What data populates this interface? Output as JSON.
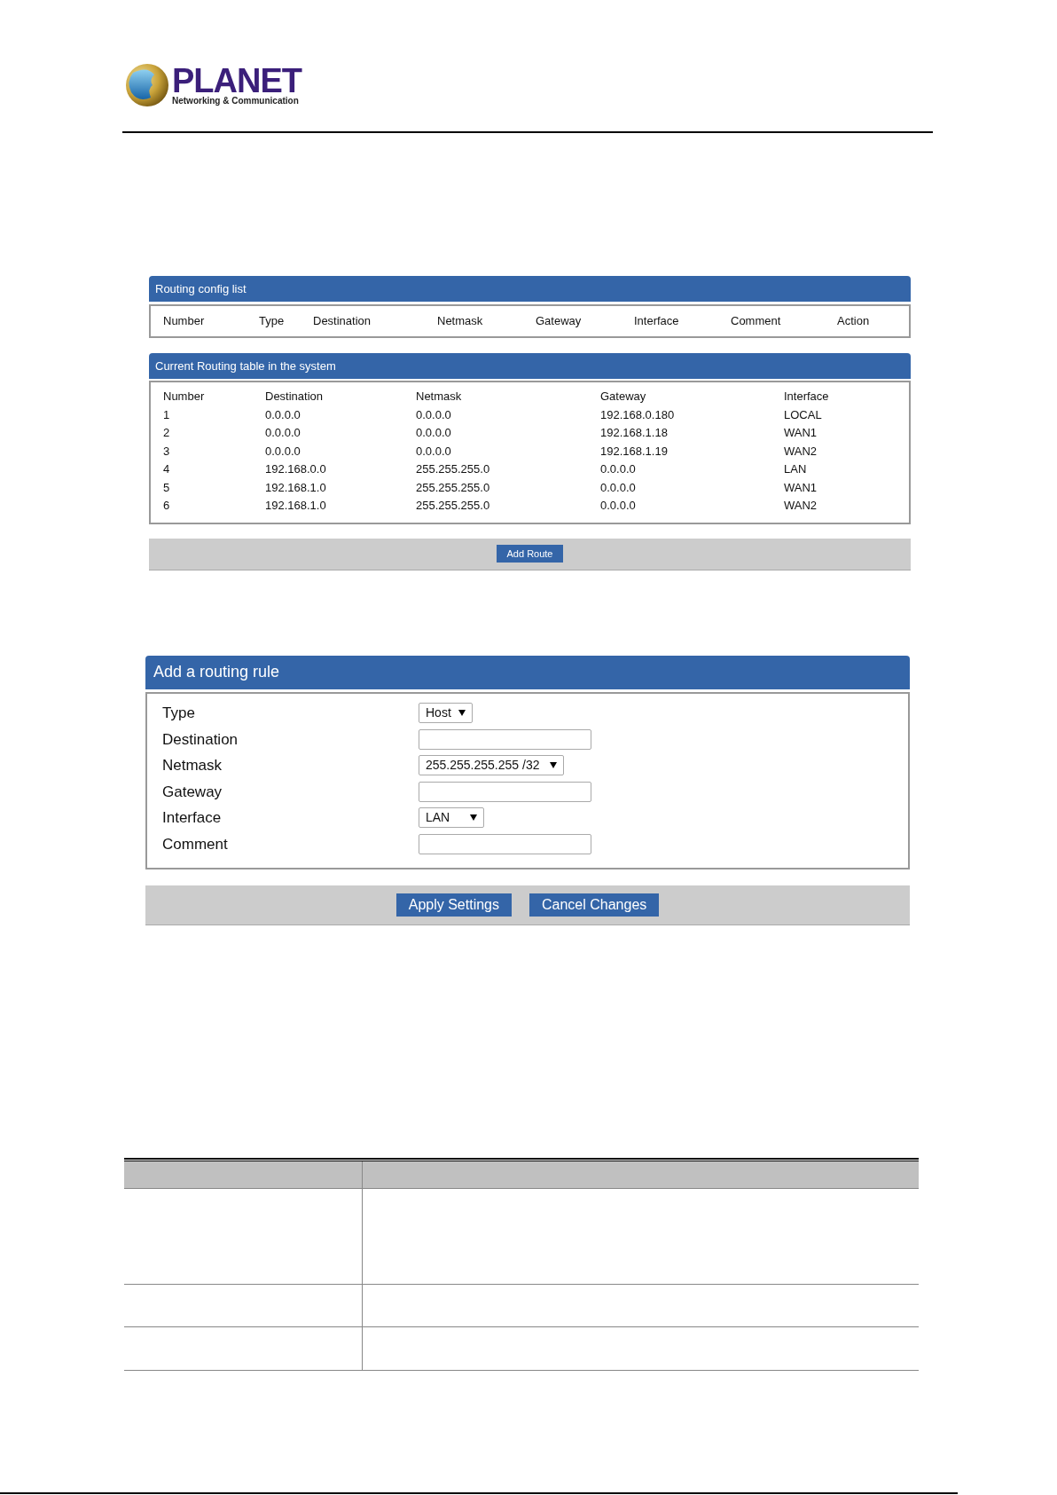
{
  "logo": {
    "name": "PLANET",
    "tagline": "Networking & Communication"
  },
  "config_list": {
    "title": "Routing config list",
    "columns": [
      "Number",
      "Type",
      "Destination",
      "Netmask",
      "Gateway",
      "Interface",
      "Comment",
      "Action"
    ]
  },
  "routing_table": {
    "title": "Current Routing table in the system",
    "columns": [
      "Number",
      "Destination",
      "Netmask",
      "Gateway",
      "Interface"
    ],
    "rows": [
      [
        "1",
        "0.0.0.0",
        "0.0.0.0",
        "192.168.0.180",
        "LOCAL"
      ],
      [
        "2",
        "0.0.0.0",
        "0.0.0.0",
        "192.168.1.18",
        "WAN1"
      ],
      [
        "3",
        "0.0.0.0",
        "0.0.0.0",
        "192.168.1.19",
        "WAN2"
      ],
      [
        "4",
        "192.168.0.0",
        "255.255.255.0",
        "0.0.0.0",
        "LAN"
      ],
      [
        "5",
        "192.168.1.0",
        "255.255.255.0",
        "0.0.0.0",
        "WAN1"
      ],
      [
        "6",
        "192.168.1.0",
        "255.255.255.0",
        "0.0.0.0",
        "WAN2"
      ]
    ]
  },
  "add_button": "Add Route",
  "add_rule": {
    "title": "Add a routing rule",
    "fields": [
      {
        "label": "Type",
        "kind": "select",
        "value": "Host"
      },
      {
        "label": "Destination",
        "kind": "text"
      },
      {
        "label": "Netmask",
        "kind": "select",
        "value": "255.255.255.255 /32"
      },
      {
        "label": "Gateway",
        "kind": "text"
      },
      {
        "label": "Interface",
        "kind": "select",
        "value": "LAN"
      },
      {
        "label": "Comment",
        "kind": "text"
      }
    ]
  },
  "buttons": [
    "Apply Settings",
    "Cancel Changes"
  ]
}
